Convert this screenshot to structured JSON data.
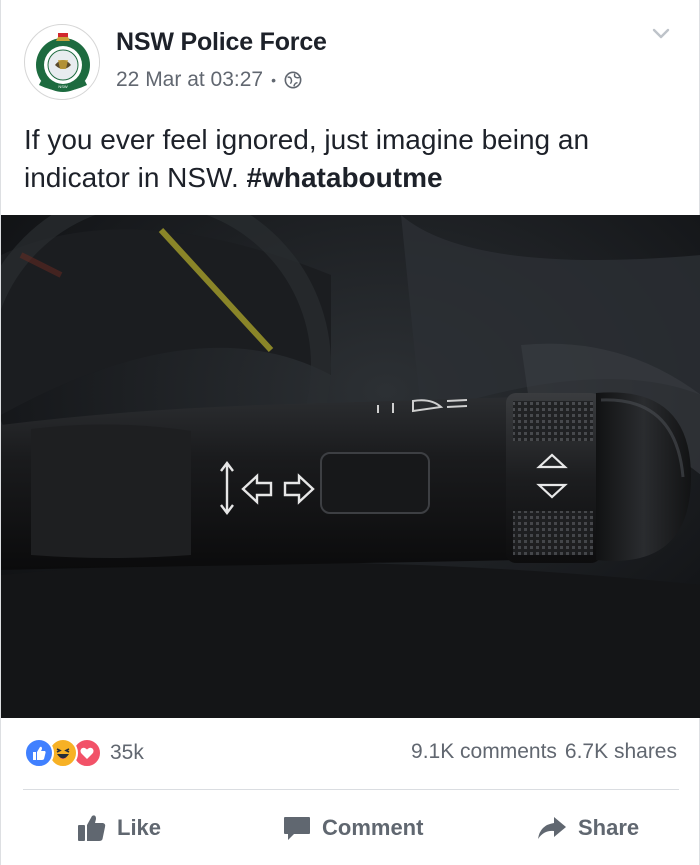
{
  "post": {
    "author": "NSW Police Force",
    "timestamp": "22 Mar at 03:27",
    "separator": "•",
    "privacy_icon": "globe-icon",
    "text_main": "If you ever feel ignored, just imagine being an indicator in NSW. ",
    "hashtag": "#whataboutme"
  },
  "reactions": {
    "icons": [
      "like-reaction-icon",
      "haha-reaction-icon",
      "love-reaction-icon"
    ],
    "count": "35k"
  },
  "stats": {
    "comments": "9.1K comments",
    "shares": "6.7K shares"
  },
  "actions": {
    "like": "Like",
    "comment": "Comment",
    "share": "Share"
  },
  "colors": {
    "like_blue": "#4080ff",
    "haha_yellow": "#f7b125",
    "love_red": "#f25268",
    "meta_gray": "#616770"
  }
}
